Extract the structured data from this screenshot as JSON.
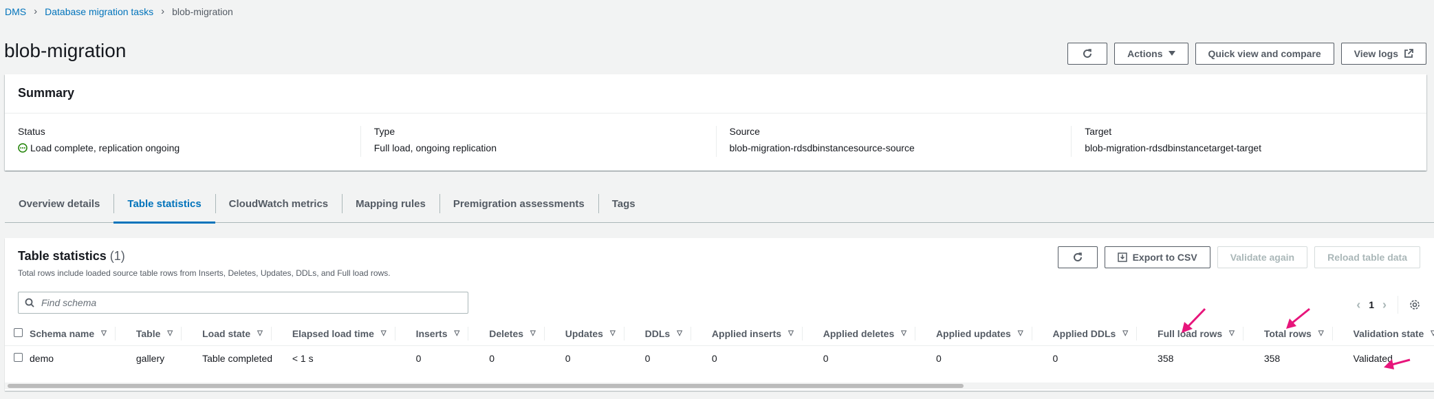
{
  "breadcrumb": {
    "root": "DMS",
    "parent": "Database migration tasks",
    "current": "blob-migration"
  },
  "page": {
    "title": "blob-migration"
  },
  "header_buttons": {
    "actions": "Actions",
    "quick_view": "Quick view and compare",
    "view_logs": "View logs"
  },
  "summary": {
    "title": "Summary",
    "status_label": "Status",
    "status_value": "Load complete, replication ongoing",
    "type_label": "Type",
    "type_value": "Full load, ongoing replication",
    "source_label": "Source",
    "source_value": "blob-migration-rdsdbinstancesource-source",
    "target_label": "Target",
    "target_value": "blob-migration-rdsdbinstancetarget-target"
  },
  "tabs": [
    "Overview details",
    "Table statistics",
    "CloudWatch metrics",
    "Mapping rules",
    "Premigration assessments",
    "Tags"
  ],
  "table_section": {
    "title": "Table statistics",
    "count": "(1)",
    "description": "Total rows include loaded source table rows from Inserts, Deletes, Updates, DDLs, and Full load rows.",
    "export_label": "Export to CSV",
    "validate_label": "Validate again",
    "reload_label": "Reload table data",
    "search_placeholder": "Find schema",
    "page_number": "1"
  },
  "columns": [
    "Schema name",
    "Table",
    "Load state",
    "Elapsed load time",
    "Inserts",
    "Deletes",
    "Updates",
    "DDLs",
    "Applied inserts",
    "Applied deletes",
    "Applied updates",
    "Applied DDLs",
    "Full load rows",
    "Total rows",
    "Validation state"
  ],
  "rows": [
    [
      "demo",
      "gallery",
      "Table completed",
      "< 1 s",
      "0",
      "0",
      "0",
      "0",
      "0",
      "0",
      "0",
      "0",
      "358",
      "358",
      "Validated"
    ]
  ],
  "colors": {
    "link": "#0073bb",
    "success": "#1d8102",
    "annotation": "#e7157b"
  }
}
